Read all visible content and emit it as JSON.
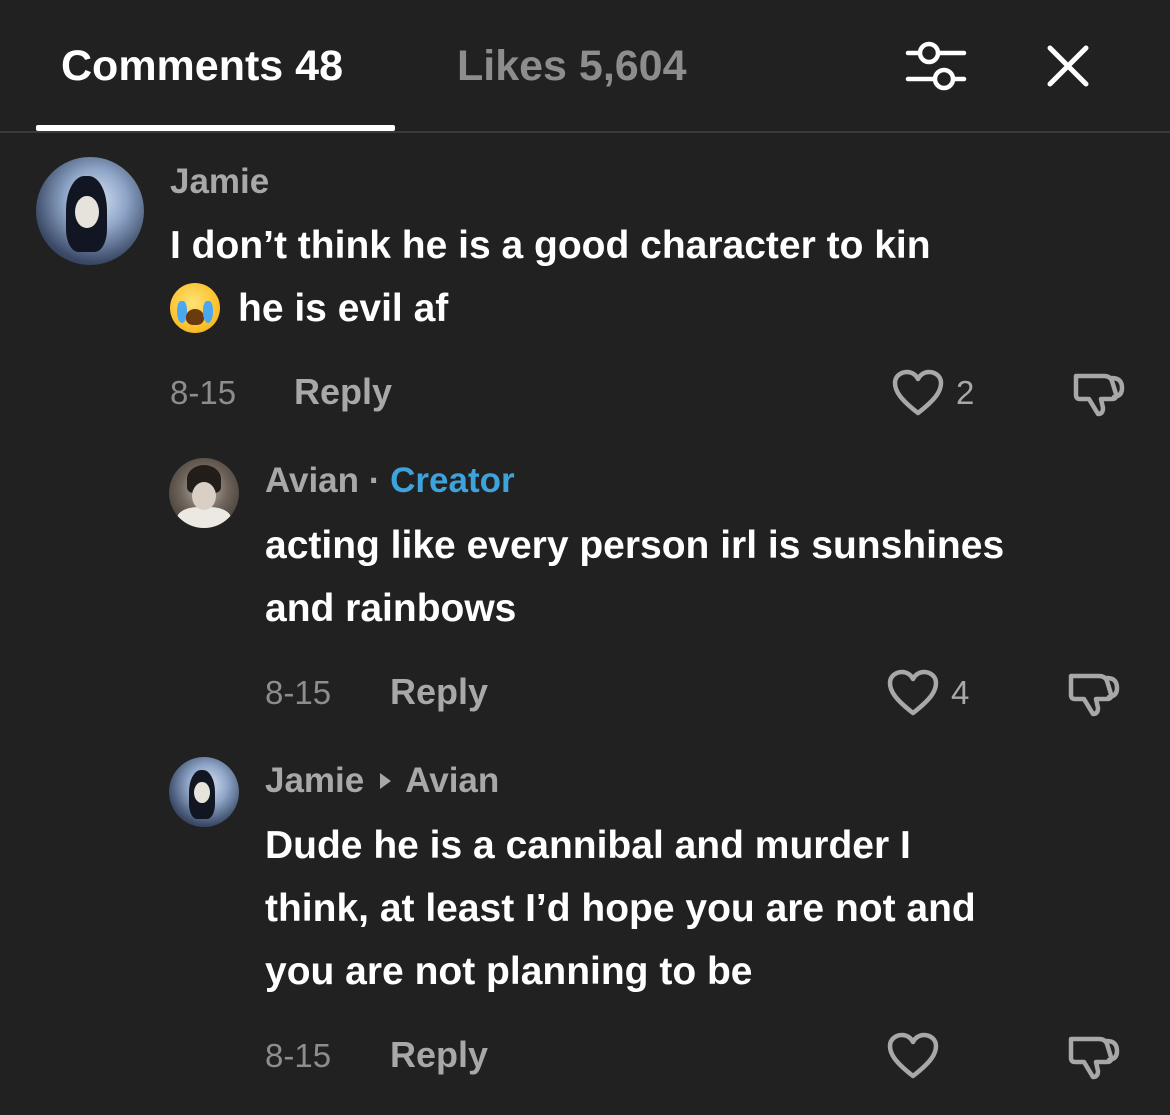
{
  "header": {
    "tab_comments": "Comments 48",
    "tab_likes": "Likes 5,604",
    "filter_icon": "sliders-icon",
    "close_icon": "close-icon"
  },
  "comments": [
    {
      "username": "Jamie",
      "lines": [
        "I don’t think he is a good character to kin",
        "he is evil af"
      ],
      "emoji": "loudly-crying-face",
      "date": "8-15",
      "reply_label": "Reply",
      "likes": "2"
    },
    {
      "username": "Avian",
      "separator": " · ",
      "badge": "Creator",
      "lines": [
        "acting like every person irl is sunshines",
        "and rainbows"
      ],
      "date": "8-15",
      "reply_label": "Reply",
      "likes": "4"
    },
    {
      "username": "Jamie",
      "reply_to": "Avian",
      "lines": [
        "Dude he is a cannibal and murder I",
        "think, at least I’d hope you are not and",
        "you are not planning to be"
      ],
      "date": "8-15",
      "reply_label": "Reply",
      "likes": ""
    }
  ],
  "colors": {
    "background": "#212121",
    "creator_badge": "#3ea3dc",
    "secondary_text": "#a8a8a8"
  }
}
